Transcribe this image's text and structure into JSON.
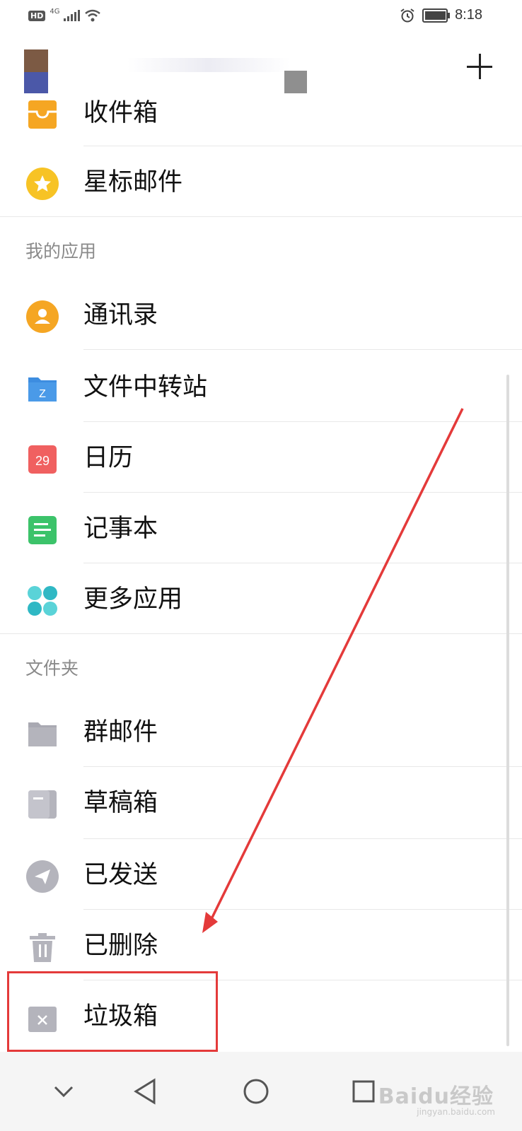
{
  "status_bar": {
    "hd": "HD",
    "network": "4G",
    "time": "8:18",
    "battery_level": 0.9
  },
  "favorites": [
    {
      "label": "收件箱",
      "icon": "inbox-icon"
    },
    {
      "label": "星标邮件",
      "icon": "star-icon"
    }
  ],
  "apps_section": {
    "title": "我的应用",
    "items": [
      {
        "label": "通讯录",
        "icon": "contacts-icon"
      },
      {
        "label": "文件中转站",
        "icon": "file-transfer-icon",
        "icon_text": "Z"
      },
      {
        "label": "日历",
        "icon": "calendar-icon",
        "icon_text": "29"
      },
      {
        "label": "记事本",
        "icon": "notepad-icon"
      },
      {
        "label": "更多应用",
        "icon": "more-apps-icon"
      }
    ]
  },
  "folders_section": {
    "title": "文件夹",
    "items": [
      {
        "label": "群邮件",
        "icon": "folder-icon"
      },
      {
        "label": "草稿箱",
        "icon": "drafts-icon"
      },
      {
        "label": "已发送",
        "icon": "sent-icon"
      },
      {
        "label": "已删除",
        "icon": "trash-icon"
      },
      {
        "label": "垃圾箱",
        "icon": "spam-icon"
      }
    ]
  },
  "watermark": {
    "text": "Baidu经验",
    "url": "jingyan.baidu.com"
  },
  "colors": {
    "orange": "#f5a623",
    "yellow": "#f7c325",
    "blue": "#3d8de0",
    "red": "#f06060",
    "green": "#3cc36a",
    "teal": "#5ad3d8",
    "gray": "#b4b4bc",
    "annotation": "#e43a3a"
  }
}
